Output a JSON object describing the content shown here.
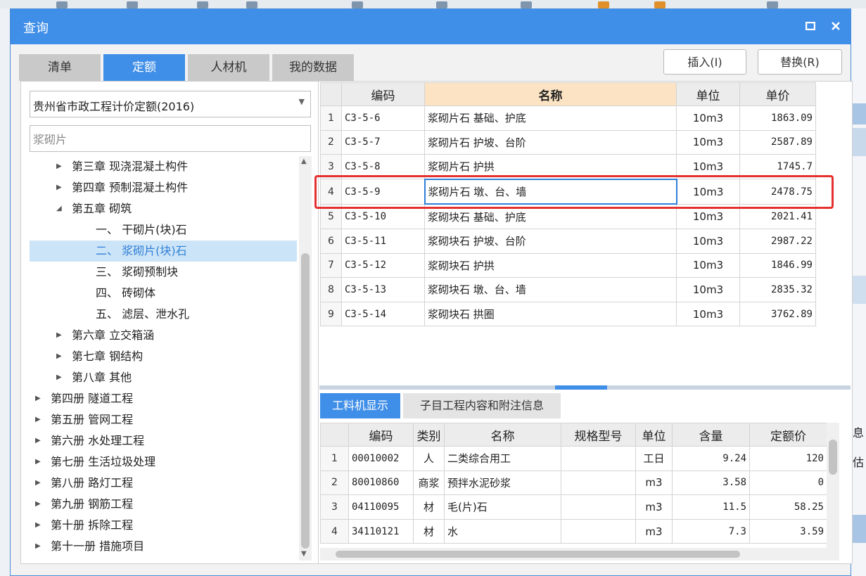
{
  "dialog": {
    "title": "查询",
    "maximize_icon": "maximize-icon",
    "close_icon": "close-icon"
  },
  "tabs": [
    {
      "label": "清单",
      "active": false
    },
    {
      "label": "定额",
      "active": true
    },
    {
      "label": "人材机",
      "active": false
    },
    {
      "label": "我的数据",
      "active": false
    }
  ],
  "buttons": {
    "insert": "插入(I)",
    "replace": "替换(R)"
  },
  "left": {
    "library": "贵州省市政工程计价定额(2016)",
    "search_value": "浆砌片",
    "tree": [
      {
        "label": "第三章 现浇混凝土构件",
        "level": 1,
        "state": "collapsed",
        "selected": false
      },
      {
        "label": "第四章 预制混凝土构件",
        "level": 1,
        "state": "collapsed",
        "selected": false
      },
      {
        "label": "第五章 砌筑",
        "level": 1,
        "state": "expanded",
        "selected": false
      },
      {
        "label": "一、 干砌片(块)石",
        "level": 2,
        "state": "leaf",
        "selected": false
      },
      {
        "label": "二、 浆砌片(块)石",
        "level": 2,
        "state": "leaf",
        "selected": true
      },
      {
        "label": "三、 浆砌预制块",
        "level": 2,
        "state": "leaf",
        "selected": false
      },
      {
        "label": "四、 砖砌体",
        "level": 2,
        "state": "leaf",
        "selected": false
      },
      {
        "label": "五、 滤层、泄水孔",
        "level": 2,
        "state": "leaf",
        "selected": false
      },
      {
        "label": "第六章 立交箱涵",
        "level": 1,
        "state": "collapsed",
        "selected": false
      },
      {
        "label": "第七章 钢结构",
        "level": 1,
        "state": "collapsed",
        "selected": false
      },
      {
        "label": "第八章 其他",
        "level": 1,
        "state": "collapsed",
        "selected": false
      },
      {
        "label": "第四册 隧道工程",
        "level": 0,
        "state": "collapsed",
        "selected": false
      },
      {
        "label": "第五册 管网工程",
        "level": 0,
        "state": "collapsed",
        "selected": false
      },
      {
        "label": "第六册 水处理工程",
        "level": 0,
        "state": "collapsed",
        "selected": false
      },
      {
        "label": "第七册 生活垃圾处理",
        "level": 0,
        "state": "collapsed",
        "selected": false
      },
      {
        "label": "第八册 路灯工程",
        "level": 0,
        "state": "collapsed",
        "selected": false
      },
      {
        "label": "第九册 钢筋工程",
        "level": 0,
        "state": "collapsed",
        "selected": false
      },
      {
        "label": "第十册 拆除工程",
        "level": 0,
        "state": "collapsed",
        "selected": false
      },
      {
        "label": "第十一册 措施项目",
        "level": 0,
        "state": "collapsed",
        "selected": false
      }
    ]
  },
  "quota_table": {
    "headers": [
      "编码",
      "名称",
      "单位",
      "单价"
    ],
    "rows": [
      {
        "idx": "1",
        "code": "C3-5-6",
        "name": "浆砌片石 基础、护底",
        "unit": "10m3",
        "price": "1863.09"
      },
      {
        "idx": "2",
        "code": "C3-5-7",
        "name": "浆砌片石 护坡、台阶",
        "unit": "10m3",
        "price": "2587.89"
      },
      {
        "idx": "3",
        "code": "C3-5-8",
        "name": "浆砌片石 护拱",
        "unit": "10m3",
        "price": "1745.7"
      },
      {
        "idx": "4",
        "code": "C3-5-9",
        "name": "浆砌片石 墩、台、墙",
        "unit": "10m3",
        "price": "2478.75"
      },
      {
        "idx": "5",
        "code": "C3-5-10",
        "name": "浆砌块石 基础、护底",
        "unit": "10m3",
        "price": "2021.41"
      },
      {
        "idx": "6",
        "code": "C3-5-11",
        "name": "浆砌块石 护坡、台阶",
        "unit": "10m3",
        "price": "2987.22"
      },
      {
        "idx": "7",
        "code": "C3-5-12",
        "name": "浆砌块石 护拱",
        "unit": "10m3",
        "price": "1846.99"
      },
      {
        "idx": "8",
        "code": "C3-5-13",
        "name": "浆砌块石 墩、台、墙",
        "unit": "10m3",
        "price": "2835.32"
      },
      {
        "idx": "9",
        "code": "C3-5-14",
        "name": "浆砌块石 拱圈",
        "unit": "10m3",
        "price": "3762.89"
      }
    ]
  },
  "subtabs": [
    {
      "label": "工料机显示",
      "active": true
    },
    {
      "label": "子目工程内容和附注信息",
      "active": false
    }
  ],
  "resource_table": {
    "headers": [
      "编码",
      "类别",
      "名称",
      "规格型号",
      "单位",
      "含量",
      "定额价"
    ],
    "rows": [
      {
        "idx": "1",
        "code": "00010002",
        "type": "人",
        "name": "二类综合用工",
        "spec": "",
        "unit": "工日",
        "qty": "9.24",
        "price": "120"
      },
      {
        "idx": "2",
        "code": "80010860",
        "type": "商浆",
        "name": "预拌水泥砂浆",
        "spec": "",
        "unit": "m3",
        "qty": "3.58",
        "price": "0"
      },
      {
        "idx": "3",
        "code": "04110095",
        "type": "材",
        "name": "毛(片)石",
        "spec": "",
        "unit": "m3",
        "qty": "11.5",
        "price": "58.25"
      },
      {
        "idx": "4",
        "code": "34110121",
        "type": "材",
        "name": "水",
        "spec": "",
        "unit": "m3",
        "qty": "7.3",
        "price": "3.59"
      }
    ]
  },
  "background_right": {
    "label_1": "息",
    "label_2": "估"
  }
}
